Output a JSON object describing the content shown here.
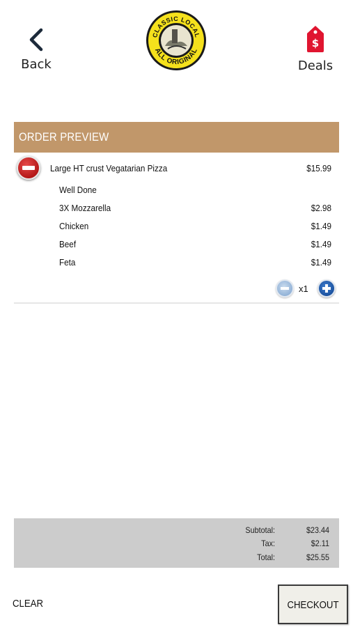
{
  "header": {
    "back_label": "Back",
    "deals_label": "Deals",
    "deals_icon_symbol": "$",
    "logo": {
      "top_text": "CLASSIC LOCAL",
      "bottom_text": "ALL ORIGINAL"
    }
  },
  "order": {
    "section_title": "ORDER PREVIEW",
    "item": {
      "name": "Large HT crust Vegatarian Pizza",
      "price": "$15.99"
    },
    "toppings": [
      {
        "name": "Well Done",
        "price": ""
      },
      {
        "name": "3X Mozzarella",
        "price": "$2.98"
      },
      {
        "name": "Chicken",
        "price": "$1.49"
      },
      {
        "name": "Beef",
        "price": "$1.49"
      },
      {
        "name": "Feta",
        "price": "$1.49"
      }
    ],
    "quantity": "x1"
  },
  "totals": {
    "subtotal_label": "Subtotal:",
    "subtotal": "$23.44",
    "tax_label": "Tax:",
    "tax": "$2.11",
    "total_label": "Total:",
    "total": "$25.55"
  },
  "footer": {
    "clear_label": "CLEAR",
    "checkout_label": "CHECKOUT"
  },
  "colors": {
    "section_bar": "#c1976a",
    "remove_button": "#c62828",
    "quantity_plus": "#1f5cae",
    "quantity_minus": "#9dbbe0",
    "deals_tag": "#e01530",
    "totals_panel": "#cccccc",
    "logo_yellow": "#f5e11c"
  },
  "icons": {
    "back": "chevron-left-icon",
    "deals": "price-tag-icon",
    "remove": "remove-circle-icon",
    "decrease": "minus-circle-icon",
    "increase": "plus-circle-icon"
  }
}
